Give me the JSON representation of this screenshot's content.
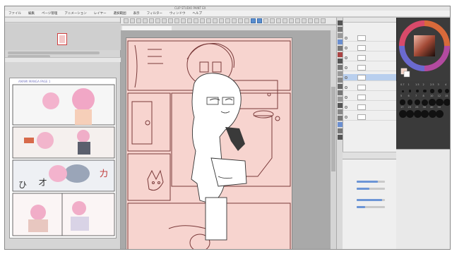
{
  "window": {
    "title": "CLIP STUDIO PAINT EX"
  },
  "menu": {
    "items": [
      "ファイル",
      "編集",
      "ページ管理",
      "アニメーション",
      "レイヤー",
      "選択範囲",
      "表示",
      "フィルター",
      "ウィンドウ",
      "ヘルプ"
    ]
  },
  "canvas_tab": {
    "label": ""
  },
  "navigator": {
    "title": ""
  },
  "subview": {
    "title": "",
    "heading_text": "AMAMI MANGA PAGE 1"
  },
  "layers": {
    "rows": [
      {
        "name": "",
        "selected": false
      },
      {
        "name": "",
        "selected": false
      },
      {
        "name": "",
        "selected": false
      },
      {
        "name": "",
        "selected": false
      },
      {
        "name": "",
        "selected": true
      },
      {
        "name": "",
        "selected": false
      },
      {
        "name": "",
        "selected": false
      },
      {
        "name": "",
        "selected": false
      },
      {
        "name": "",
        "selected": false
      }
    ]
  },
  "brush_sizes": [
    "0.7",
    "1",
    "1.5",
    "2",
    "2.5",
    "3",
    "4",
    "5",
    "6",
    "7",
    "8",
    "10",
    "12",
    "15",
    "17",
    "20",
    "25",
    "30",
    "40",
    "50"
  ],
  "tool_property": {
    "rows": [
      "",
      "",
      "",
      "",
      "",
      "",
      "",
      "",
      "",
      "",
      "",
      "",
      "",
      "",
      "",
      "",
      ""
    ]
  },
  "colors": {
    "app_bg": "#bdbdbd",
    "page_tint": "#f7d4cf",
    "line_art": "#7a3a3a",
    "selection": "#b9cfee",
    "accent": "#5b8fd0"
  },
  "icons": {
    "navigator": "page-thumbnail-icon",
    "eye": "eye-icon",
    "brush": "brush-tip-icon"
  }
}
